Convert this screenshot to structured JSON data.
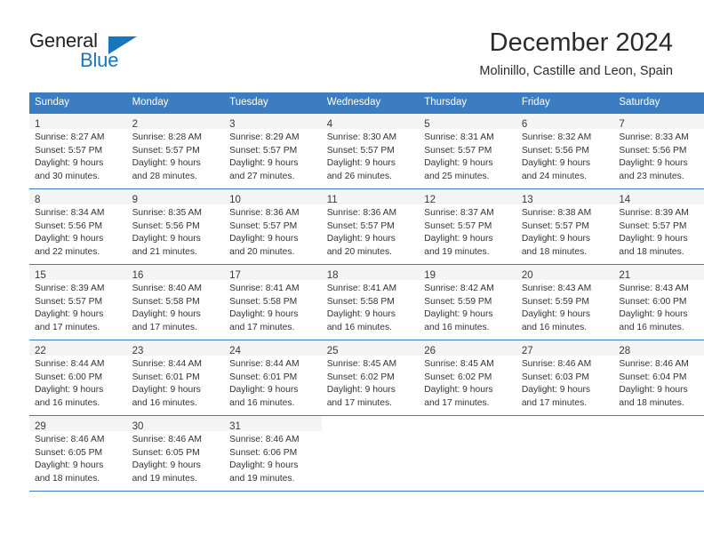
{
  "brand": {
    "name_part1": "General",
    "name_part2": "Blue",
    "accent_color": "#1b75bb",
    "logo_icon": "triangle-flag-icon"
  },
  "header": {
    "month_title": "December 2024",
    "location": "Molinillo, Castille and Leon, Spain"
  },
  "calendar": {
    "header_color": "#3b7dc0",
    "weekday_headers": [
      "Sunday",
      "Monday",
      "Tuesday",
      "Wednesday",
      "Thursday",
      "Friday",
      "Saturday"
    ],
    "weeks": [
      [
        {
          "day": "1",
          "sunrise": "Sunrise: 8:27 AM",
          "sunset": "Sunset: 5:57 PM",
          "daylight_line1": "Daylight: 9 hours",
          "daylight_line2": "and 30 minutes."
        },
        {
          "day": "2",
          "sunrise": "Sunrise: 8:28 AM",
          "sunset": "Sunset: 5:57 PM",
          "daylight_line1": "Daylight: 9 hours",
          "daylight_line2": "and 28 minutes."
        },
        {
          "day": "3",
          "sunrise": "Sunrise: 8:29 AM",
          "sunset": "Sunset: 5:57 PM",
          "daylight_line1": "Daylight: 9 hours",
          "daylight_line2": "and 27 minutes."
        },
        {
          "day": "4",
          "sunrise": "Sunrise: 8:30 AM",
          "sunset": "Sunset: 5:57 PM",
          "daylight_line1": "Daylight: 9 hours",
          "daylight_line2": "and 26 minutes."
        },
        {
          "day": "5",
          "sunrise": "Sunrise: 8:31 AM",
          "sunset": "Sunset: 5:57 PM",
          "daylight_line1": "Daylight: 9 hours",
          "daylight_line2": "and 25 minutes."
        },
        {
          "day": "6",
          "sunrise": "Sunrise: 8:32 AM",
          "sunset": "Sunset: 5:56 PM",
          "daylight_line1": "Daylight: 9 hours",
          "daylight_line2": "and 24 minutes."
        },
        {
          "day": "7",
          "sunrise": "Sunrise: 8:33 AM",
          "sunset": "Sunset: 5:56 PM",
          "daylight_line1": "Daylight: 9 hours",
          "daylight_line2": "and 23 minutes."
        }
      ],
      [
        {
          "day": "8",
          "sunrise": "Sunrise: 8:34 AM",
          "sunset": "Sunset: 5:56 PM",
          "daylight_line1": "Daylight: 9 hours",
          "daylight_line2": "and 22 minutes."
        },
        {
          "day": "9",
          "sunrise": "Sunrise: 8:35 AM",
          "sunset": "Sunset: 5:56 PM",
          "daylight_line1": "Daylight: 9 hours",
          "daylight_line2": "and 21 minutes."
        },
        {
          "day": "10",
          "sunrise": "Sunrise: 8:36 AM",
          "sunset": "Sunset: 5:57 PM",
          "daylight_line1": "Daylight: 9 hours",
          "daylight_line2": "and 20 minutes."
        },
        {
          "day": "11",
          "sunrise": "Sunrise: 8:36 AM",
          "sunset": "Sunset: 5:57 PM",
          "daylight_line1": "Daylight: 9 hours",
          "daylight_line2": "and 20 minutes."
        },
        {
          "day": "12",
          "sunrise": "Sunrise: 8:37 AM",
          "sunset": "Sunset: 5:57 PM",
          "daylight_line1": "Daylight: 9 hours",
          "daylight_line2": "and 19 minutes."
        },
        {
          "day": "13",
          "sunrise": "Sunrise: 8:38 AM",
          "sunset": "Sunset: 5:57 PM",
          "daylight_line1": "Daylight: 9 hours",
          "daylight_line2": "and 18 minutes."
        },
        {
          "day": "14",
          "sunrise": "Sunrise: 8:39 AM",
          "sunset": "Sunset: 5:57 PM",
          "daylight_line1": "Daylight: 9 hours",
          "daylight_line2": "and 18 minutes."
        }
      ],
      [
        {
          "day": "15",
          "sunrise": "Sunrise: 8:39 AM",
          "sunset": "Sunset: 5:57 PM",
          "daylight_line1": "Daylight: 9 hours",
          "daylight_line2": "and 17 minutes."
        },
        {
          "day": "16",
          "sunrise": "Sunrise: 8:40 AM",
          "sunset": "Sunset: 5:58 PM",
          "daylight_line1": "Daylight: 9 hours",
          "daylight_line2": "and 17 minutes."
        },
        {
          "day": "17",
          "sunrise": "Sunrise: 8:41 AM",
          "sunset": "Sunset: 5:58 PM",
          "daylight_line1": "Daylight: 9 hours",
          "daylight_line2": "and 17 minutes."
        },
        {
          "day": "18",
          "sunrise": "Sunrise: 8:41 AM",
          "sunset": "Sunset: 5:58 PM",
          "daylight_line1": "Daylight: 9 hours",
          "daylight_line2": "and 16 minutes."
        },
        {
          "day": "19",
          "sunrise": "Sunrise: 8:42 AM",
          "sunset": "Sunset: 5:59 PM",
          "daylight_line1": "Daylight: 9 hours",
          "daylight_line2": "and 16 minutes."
        },
        {
          "day": "20",
          "sunrise": "Sunrise: 8:43 AM",
          "sunset": "Sunset: 5:59 PM",
          "daylight_line1": "Daylight: 9 hours",
          "daylight_line2": "and 16 minutes."
        },
        {
          "day": "21",
          "sunrise": "Sunrise: 8:43 AM",
          "sunset": "Sunset: 6:00 PM",
          "daylight_line1": "Daylight: 9 hours",
          "daylight_line2": "and 16 minutes."
        }
      ],
      [
        {
          "day": "22",
          "sunrise": "Sunrise: 8:44 AM",
          "sunset": "Sunset: 6:00 PM",
          "daylight_line1": "Daylight: 9 hours",
          "daylight_line2": "and 16 minutes."
        },
        {
          "day": "23",
          "sunrise": "Sunrise: 8:44 AM",
          "sunset": "Sunset: 6:01 PM",
          "daylight_line1": "Daylight: 9 hours",
          "daylight_line2": "and 16 minutes."
        },
        {
          "day": "24",
          "sunrise": "Sunrise: 8:44 AM",
          "sunset": "Sunset: 6:01 PM",
          "daylight_line1": "Daylight: 9 hours",
          "daylight_line2": "and 16 minutes."
        },
        {
          "day": "25",
          "sunrise": "Sunrise: 8:45 AM",
          "sunset": "Sunset: 6:02 PM",
          "daylight_line1": "Daylight: 9 hours",
          "daylight_line2": "and 17 minutes."
        },
        {
          "day": "26",
          "sunrise": "Sunrise: 8:45 AM",
          "sunset": "Sunset: 6:02 PM",
          "daylight_line1": "Daylight: 9 hours",
          "daylight_line2": "and 17 minutes."
        },
        {
          "day": "27",
          "sunrise": "Sunrise: 8:46 AM",
          "sunset": "Sunset: 6:03 PM",
          "daylight_line1": "Daylight: 9 hours",
          "daylight_line2": "and 17 minutes."
        },
        {
          "day": "28",
          "sunrise": "Sunrise: 8:46 AM",
          "sunset": "Sunset: 6:04 PM",
          "daylight_line1": "Daylight: 9 hours",
          "daylight_line2": "and 18 minutes."
        }
      ],
      [
        {
          "day": "29",
          "sunrise": "Sunrise: 8:46 AM",
          "sunset": "Sunset: 6:05 PM",
          "daylight_line1": "Daylight: 9 hours",
          "daylight_line2": "and 18 minutes."
        },
        {
          "day": "30",
          "sunrise": "Sunrise: 8:46 AM",
          "sunset": "Sunset: 6:05 PM",
          "daylight_line1": "Daylight: 9 hours",
          "daylight_line2": "and 19 minutes."
        },
        {
          "day": "31",
          "sunrise": "Sunrise: 8:46 AM",
          "sunset": "Sunset: 6:06 PM",
          "daylight_line1": "Daylight: 9 hours",
          "daylight_line2": "and 19 minutes."
        },
        null,
        null,
        null,
        null
      ]
    ]
  }
}
